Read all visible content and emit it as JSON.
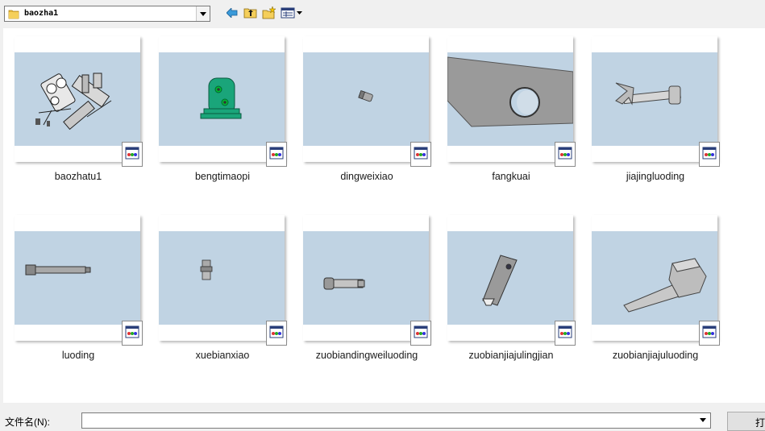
{
  "toolbar": {
    "location": "baozha1",
    "icons": [
      "folder-icon",
      "back-arrow-icon",
      "up-folder-icon",
      "new-folder-icon",
      "view-menu-icon"
    ]
  },
  "files": [
    {
      "name": "baozhatu1",
      "badge_icon": "part-file-icon"
    },
    {
      "name": "bengtimaopi",
      "badge_icon": "part-file-icon"
    },
    {
      "name": "dingweixiao",
      "badge_icon": "part-file-icon"
    },
    {
      "name": "fangkuai",
      "badge_icon": "part-file-icon"
    },
    {
      "name": "jiajingluoding",
      "badge_icon": "part-file-icon"
    },
    {
      "name": "luoding",
      "badge_icon": "part-file-icon"
    },
    {
      "name": "xuebianxiao",
      "badge_icon": "part-file-icon"
    },
    {
      "name": "zuobiandingweiluoding",
      "badge_icon": "part-file-icon"
    },
    {
      "name": "zuobianjiajulingjian",
      "badge_icon": "part-file-icon"
    },
    {
      "name": "zuobianjiajuluoding",
      "badge_icon": "part-file-icon"
    }
  ],
  "footer": {
    "filename_label": "文件名(N):",
    "filename_value": "",
    "open_button": "打"
  },
  "colors": {
    "thumb_background": "#c0d3e3",
    "window_background": "#f0f0f0",
    "view_background": "#ffffff"
  }
}
